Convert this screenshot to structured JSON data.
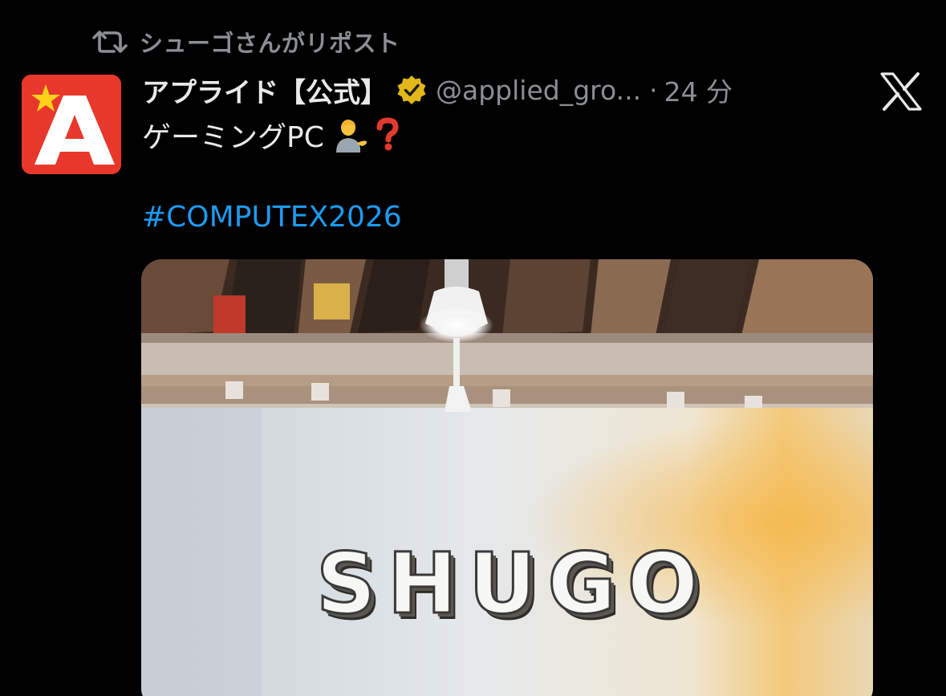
{
  "repost": {
    "icon": "repost-icon",
    "text": "シューゴさんがリポスト"
  },
  "author": {
    "avatar_icon": "applied-logo-avatar",
    "avatar_letter": "A",
    "display_name": "アプライド【公式】",
    "verified_icon": "gold-verified-badge-icon",
    "handle": "@applied_gro...",
    "separator": "·",
    "time": "24 分"
  },
  "platform_icon": "x-logo-icon",
  "tweet": {
    "text": "ゲーミングPC",
    "emoji_1": "person-tipping-hand-emoji",
    "emoji_2": "red-question-mark-emoji",
    "hashtag": "#COMPUTEX2026"
  },
  "media": {
    "type": "photo",
    "sign_text": "SHUGO"
  },
  "colors": {
    "background": "#000000",
    "primary_text": "#e7e9ea",
    "secondary_text": "#8b8f93",
    "link": "#1d9bf0",
    "avatar_red": "#e8382c",
    "verified_gold": "#e2b719"
  }
}
